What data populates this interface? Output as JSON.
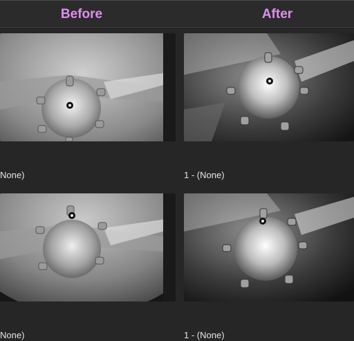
{
  "header": {
    "before_label": "Before",
    "after_label": "After"
  },
  "rows": [
    {
      "before_caption": "None)",
      "after_caption": "1 - (None)"
    },
    {
      "before_caption": "None)",
      "after_caption": "1 - (None)"
    }
  ],
  "colors": {
    "background": "#262626",
    "header_text": "#e08ef0",
    "caption_text": "#e6e6e6"
  }
}
